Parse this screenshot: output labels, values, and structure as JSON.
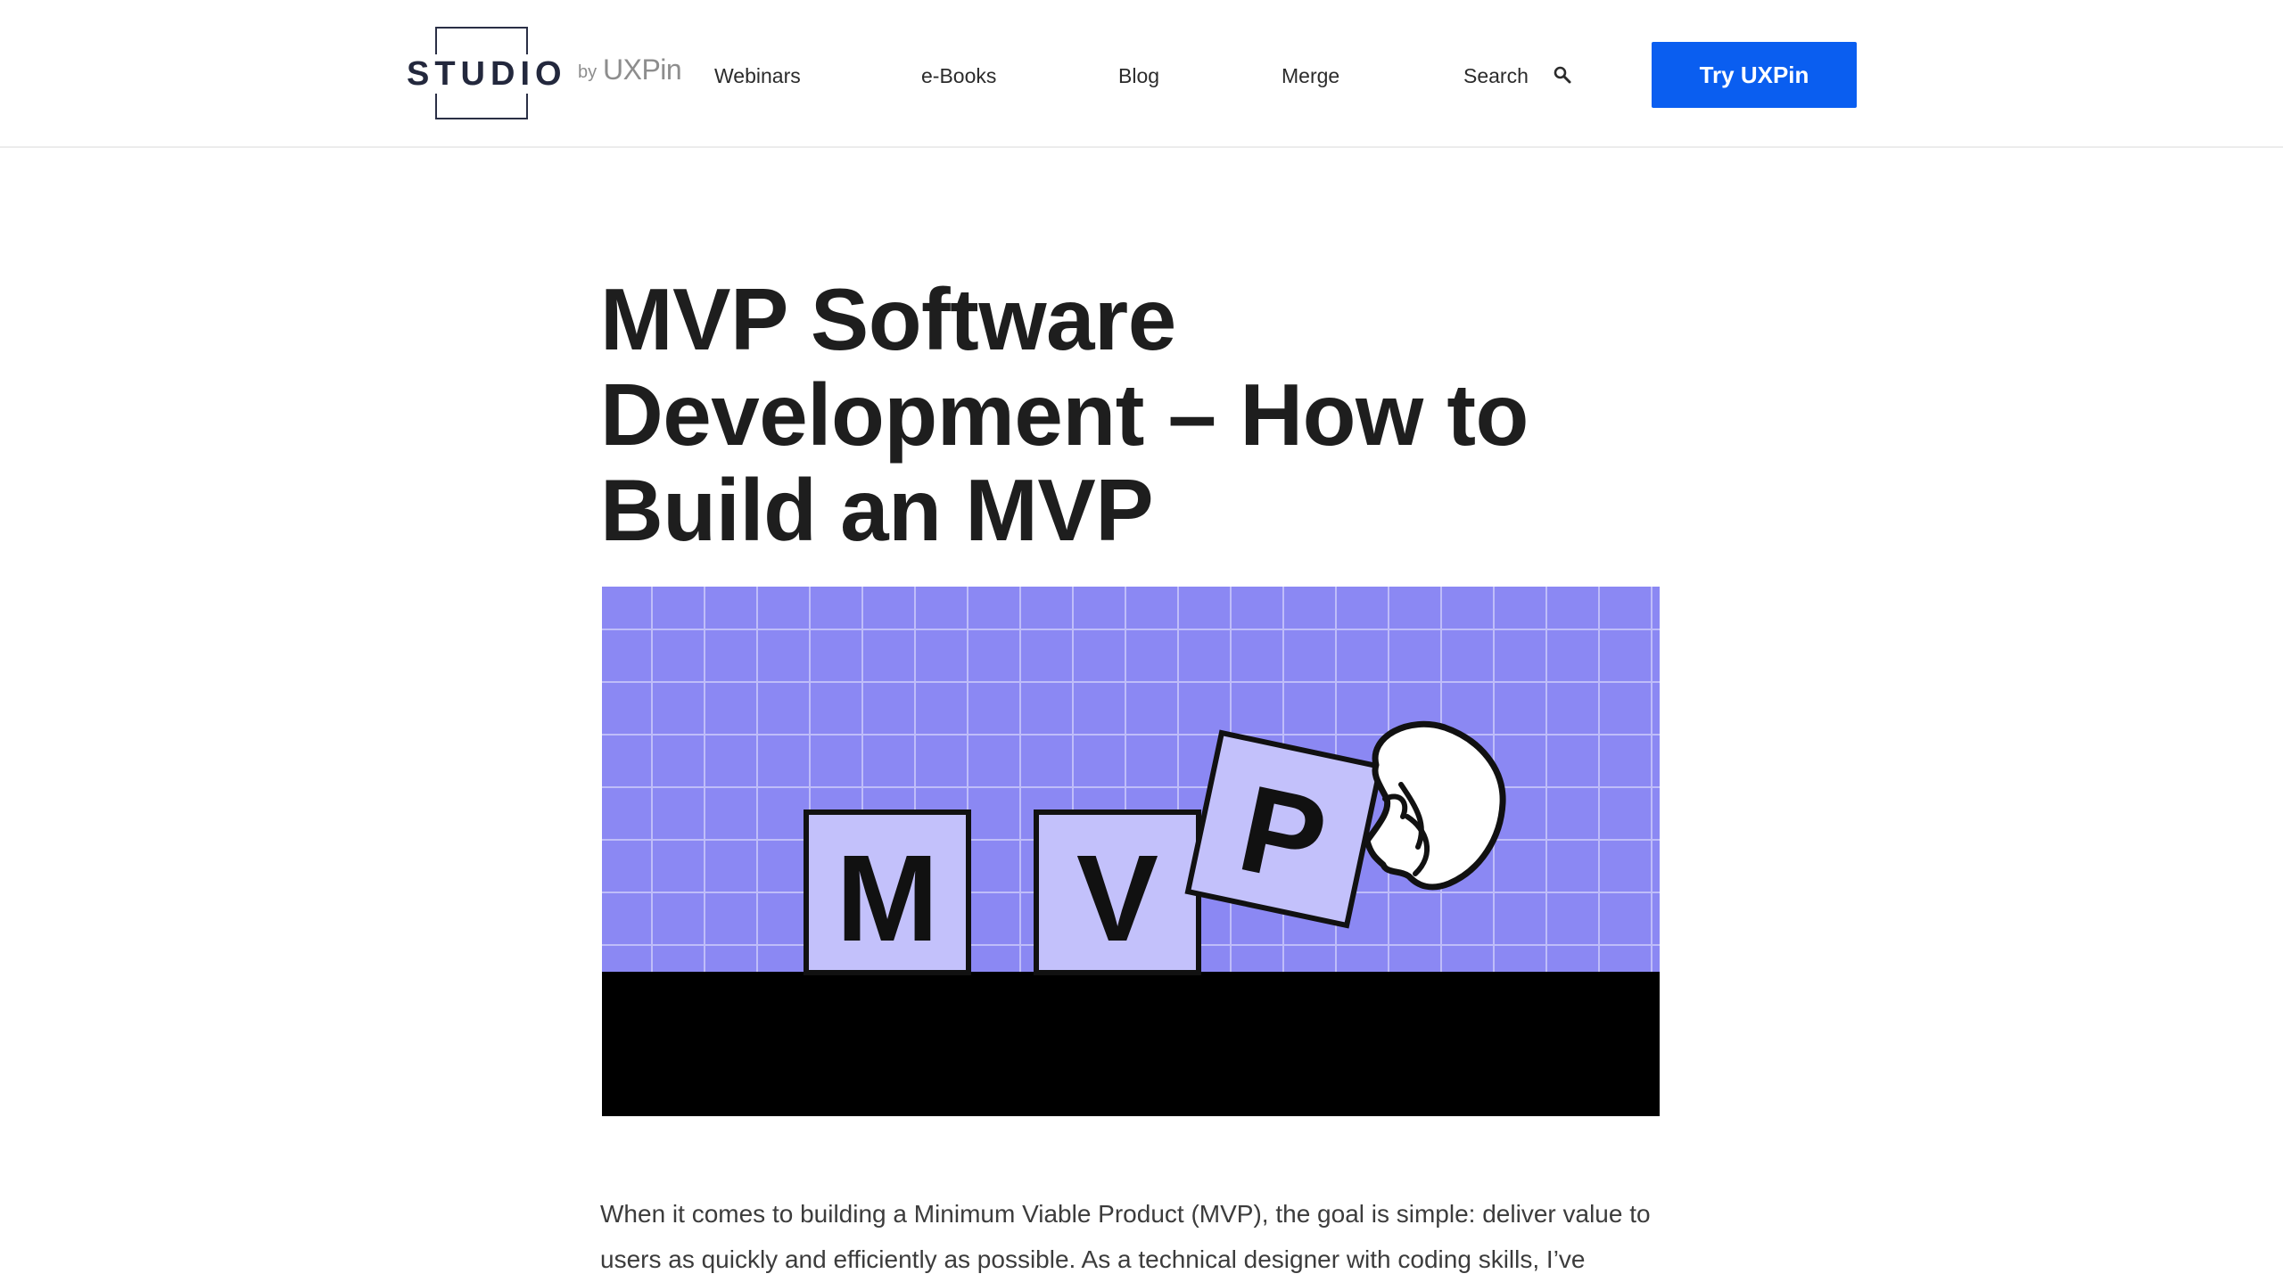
{
  "header": {
    "logo": {
      "word": "STUDIO",
      "by": "by",
      "brand": "UXPin"
    },
    "nav": [
      {
        "label": "Webinars"
      },
      {
        "label": "e-Books"
      },
      {
        "label": "Blog"
      },
      {
        "label": "Merge"
      },
      {
        "label": "Search"
      }
    ],
    "search_icon": "magnifier-icon",
    "cta_label": "Try UXPin",
    "colors": {
      "cta": "#0a5ef0",
      "divider": "#ececec"
    }
  },
  "article": {
    "title": "MVP Software Development – How to Build an MVP",
    "hero": {
      "tiles": [
        "M",
        "V",
        "P"
      ],
      "colors": {
        "grid_bg": "#8b88f3",
        "grid_lines": "#c9c7fb",
        "tile": "#c3c1fb",
        "ground": "#000000"
      }
    },
    "intro": "When it comes to building a Minimum Viable Product (MVP), the goal is simple: deliver value to users as quickly and efficiently as possible. As a technical designer with coding skills, I’ve"
  }
}
